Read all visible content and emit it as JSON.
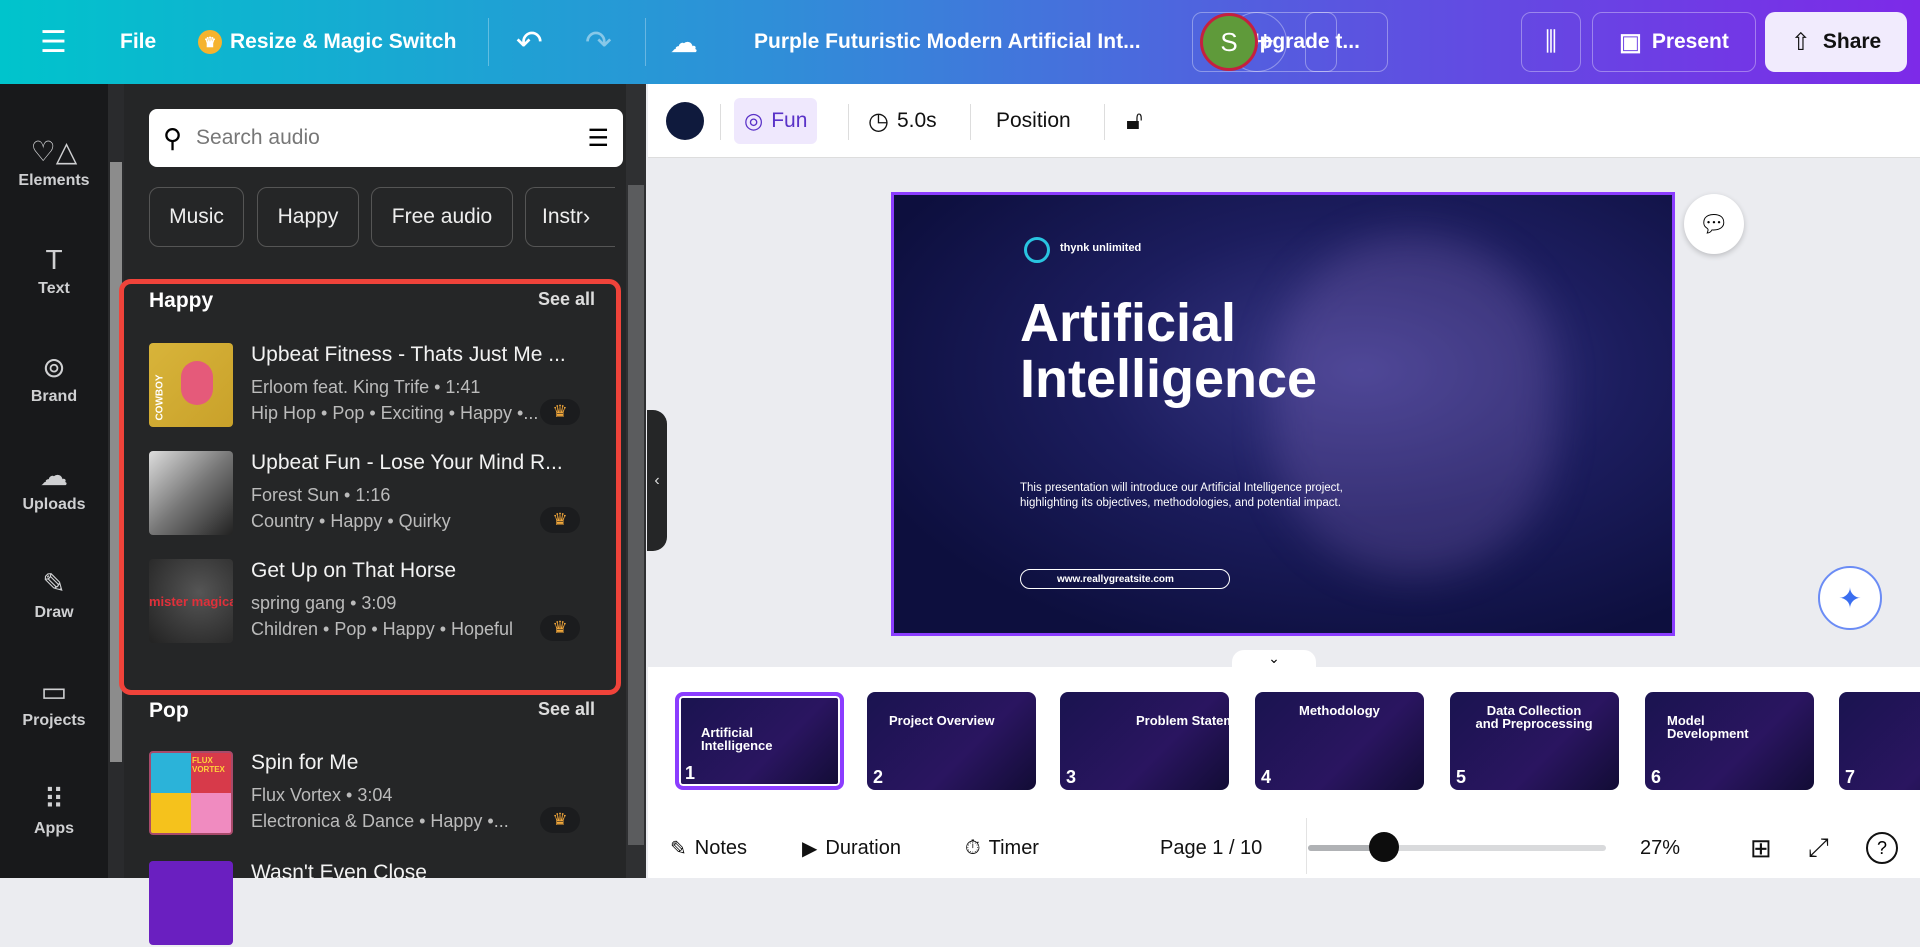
{
  "topbar": {
    "menu_icon": "hamburger-icon",
    "file": "File",
    "resize": "Resize & Magic Switch",
    "doc_title": "Purple Futuristic Modern Artificial Int...",
    "upgrade": "Upgrade t...",
    "avatar_letter": "S",
    "present": "Present",
    "share": "Share",
    "brand_gradient": [
      "#00c4cc",
      "#7d2ae8"
    ]
  },
  "rail": [
    {
      "label": "Elements",
      "icon": "elements-icon"
    },
    {
      "label": "Text",
      "icon": "text-icon"
    },
    {
      "label": "Brand",
      "icon": "brand-icon"
    },
    {
      "label": "Uploads",
      "icon": "uploads-icon"
    },
    {
      "label": "Draw",
      "icon": "draw-icon"
    },
    {
      "label": "Projects",
      "icon": "projects-icon"
    },
    {
      "label": "Apps",
      "icon": "apps-icon"
    }
  ],
  "panel": {
    "search_placeholder": "Search audio",
    "chips": [
      "Music",
      "Happy",
      "Free audio",
      "Instr"
    ],
    "sections": [
      {
        "title": "Happy",
        "see_all": "See all",
        "tracks": [
          {
            "title": "Upbeat Fitness - Thats Just Me ...",
            "artist": "Erloom feat. King Trife • 1:41",
            "tags": "Hip Hop • Pop • Exciting • Happy •..."
          },
          {
            "title": "Upbeat Fun - Lose Your Mind R...",
            "artist": "Forest Sun • 1:16",
            "tags": "Country • Happy • Quirky"
          },
          {
            "title": "Get Up on That Horse",
            "artist": "spring gang • 3:09",
            "tags": "Children • Pop • Happy • Hopeful"
          }
        ]
      },
      {
        "title": "Pop",
        "see_all": "See all",
        "tracks": [
          {
            "title": "Spin for Me",
            "artist": "Flux Vortex • 3:04",
            "tags": "Electronica & Dance • Happy •..."
          },
          {
            "title": "Wasn't Even Close"
          }
        ]
      }
    ],
    "art_text": [
      "COWBOY",
      "mister magical",
      "FLUX VORTEX"
    ]
  },
  "toolbar": {
    "color": "#0f1a3d",
    "animation": "Fun",
    "duration": "5.0s",
    "position": "Position"
  },
  "slide": {
    "brand": "thynk unlimited",
    "title_line1": "Artificial",
    "title_line2": "Intelligence",
    "description": "This presentation will introduce our Artificial Intelligence project, highlighting its objectives, methodologies, and potential impact.",
    "url": "www.reallygreatsite.com"
  },
  "thumbnails": [
    {
      "n": "1",
      "title": "Artificial Intelligence"
    },
    {
      "n": "2",
      "title": "Project Overview"
    },
    {
      "n": "3",
      "title": "Problem Statement"
    },
    {
      "n": "4",
      "title": "Methodology"
    },
    {
      "n": "5",
      "title": "Data Collection and Preprocessing"
    },
    {
      "n": "6",
      "title": "Model Development"
    },
    {
      "n": "7",
      "title": ""
    }
  ],
  "bottombar": {
    "notes": "Notes",
    "duration": "Duration",
    "timer": "Timer",
    "page": "Page 1 / 10",
    "zoom": "27%",
    "zoom_value_percent": 27
  }
}
